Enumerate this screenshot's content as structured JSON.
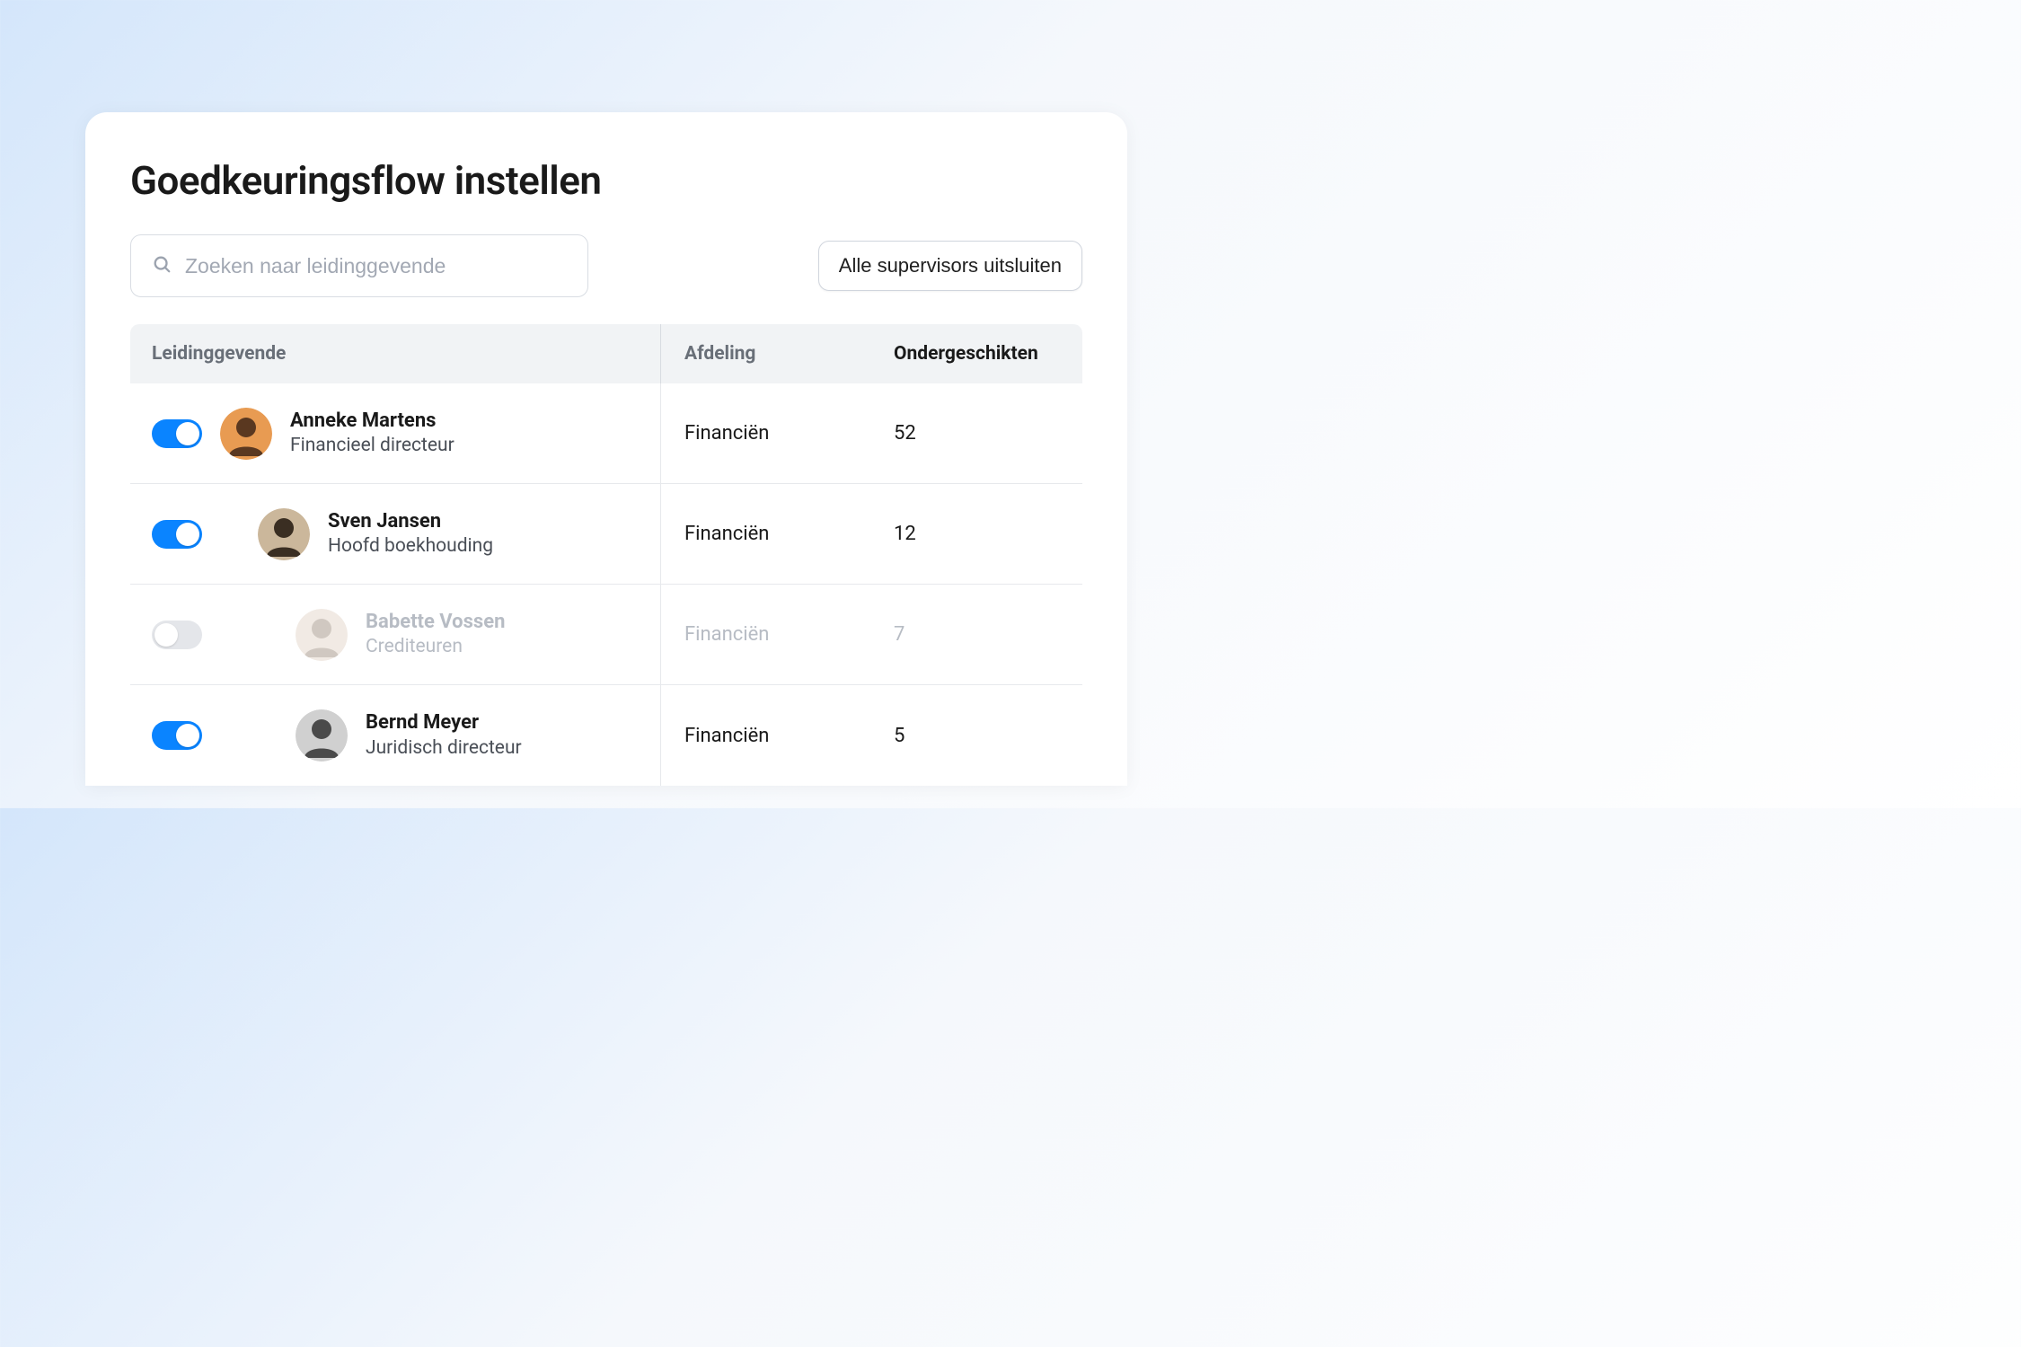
{
  "title": "Goedkeuringsflow instellen",
  "search": {
    "placeholder": "Zoeken naar leidinggevende"
  },
  "actions": {
    "exclude_all_label": "Alle supervisors uitsluiten"
  },
  "columns": {
    "leader": "Leidinggevende",
    "department": "Afdeling",
    "subordinates": "Ondergeschikten"
  },
  "rows": [
    {
      "enabled": true,
      "indent": 0,
      "name": "Anneke Martens",
      "role": "Financieel directeur",
      "department": "Financiën",
      "subordinates": "52",
      "avatar_bg": "#e89b52",
      "avatar_fg": "#5a3820"
    },
    {
      "enabled": true,
      "indent": 1,
      "name": "Sven Jansen",
      "role": "Hoofd boekhouding",
      "department": "Financiën",
      "subordinates": "12",
      "avatar_bg": "#cbb79b",
      "avatar_fg": "#3a2e22"
    },
    {
      "enabled": false,
      "indent": 2,
      "name": "Babette Vossen",
      "role": "Crediteuren",
      "department": "Financiën",
      "subordinates": "7",
      "avatar_bg": "#d9c6b3",
      "avatar_fg": "#7a6550"
    },
    {
      "enabled": true,
      "indent": 2,
      "name": "Bernd Meyer",
      "role": "Juridisch directeur",
      "department": "Financiën",
      "subordinates": "5",
      "avatar_bg": "#d0d0d0",
      "avatar_fg": "#4a4a4a"
    }
  ]
}
